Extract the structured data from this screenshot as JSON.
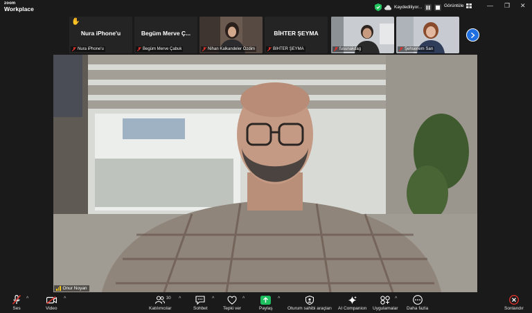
{
  "app": {
    "brand_line1": "zoom",
    "brand_line2": "Workplace"
  },
  "recording": {
    "status": "Kaydediliyor..."
  },
  "view_menu": {
    "label": "Görüntüle"
  },
  "thumbnails": [
    {
      "display_name": "Nura iPhone'u",
      "label": "Nura iPhone'u",
      "muted": true,
      "hand_raised": true,
      "video": false
    },
    {
      "display_name": "Begüm  Merve  Ç...",
      "label": "Begüm Merve Çabuk",
      "muted": true,
      "hand_raised": false,
      "video": false
    },
    {
      "display_name": "",
      "label": "Nihan Kalkandeler Özdim",
      "muted": true,
      "hand_raised": false,
      "video": true
    },
    {
      "display_name": "BİHTER ŞEYMA",
      "label": "BİHTER ŞEYMA",
      "muted": true,
      "hand_raised": false,
      "video": false
    },
    {
      "display_name": "",
      "label": "fusunakdag",
      "muted": true,
      "hand_raised": false,
      "video": true
    },
    {
      "display_name": "",
      "label": "Şehsenem Sarı",
      "muted": true,
      "hand_raised": false,
      "video": true
    }
  ],
  "main_speaker": {
    "name": "Onur Noyan"
  },
  "toolbar": {
    "audio": "Ses",
    "video": "Video",
    "participants": "Katılımcılar",
    "participants_count": "30",
    "chat": "Sohbet",
    "react": "Tepki ver",
    "share": "Paylaş",
    "host_tools": "Oturum sahibi araçları",
    "ai_companion": "AI Companion",
    "apps": "Uygulamalar",
    "more": "Daha fazla",
    "end": "Sonlandır"
  },
  "colors": {
    "share_green": "#1fbf5f",
    "end_red": "#e0312b",
    "accent_blue": "#1f6fe0",
    "shield_green": "#22c55e"
  }
}
